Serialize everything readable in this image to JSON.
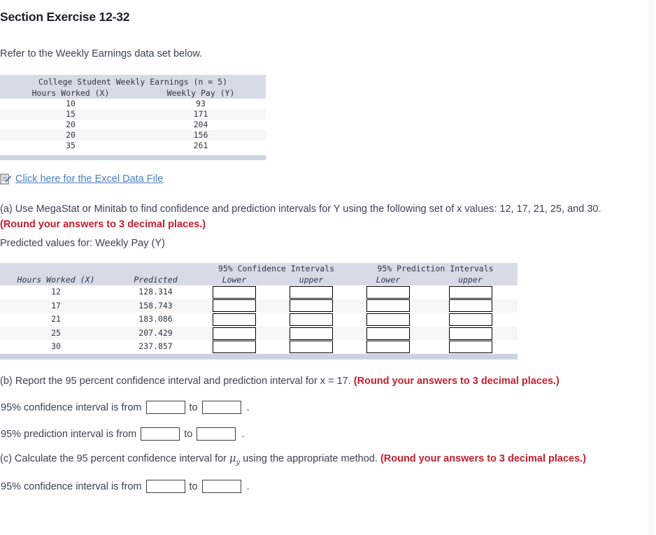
{
  "header": {
    "title": "Section Exercise 12-32",
    "intro": "Refer to the Weekly Earnings data set below."
  },
  "dataset_table": {
    "title": "College Student Weekly Earnings (n = 5)",
    "columns": [
      "Hours Worked (X)",
      "Weekly Pay (Y)"
    ],
    "rows": [
      {
        "x": "10",
        "y": "93"
      },
      {
        "x": "15",
        "y": "171"
      },
      {
        "x": "20",
        "y": "204"
      },
      {
        "x": "20",
        "y": "156"
      },
      {
        "x": "35",
        "y": "261"
      }
    ]
  },
  "excel": {
    "icon": "excel-document-icon",
    "link_text": "Click here for the Excel Data File"
  },
  "question_a": {
    "text": "(a) Use MegaStat or Minitab to find confidence and prediction intervals for Y using the following set of x values: 12, 17, 21, 25, and 30.",
    "round_note": "(Round your answers to 3 decimal places.)",
    "predicted_label": "Predicted values for: Weekly Pay (Y)"
  },
  "results_table": {
    "group_headers": {
      "confidence": "95% Confidence Intervals",
      "prediction": "95% Prediction Intervals"
    },
    "columns": {
      "x": "Hours Worked (X)",
      "predicted": "Predicted",
      "conf_lower": "Lower",
      "conf_upper": "upper",
      "pred_lower": "Lower",
      "pred_upper": "upper"
    },
    "rows": [
      {
        "x": "12",
        "predicted": "128.314",
        "conf_lower": "",
        "conf_upper": "",
        "pred_lower": "",
        "pred_upper": ""
      },
      {
        "x": "17",
        "predicted": "158.743",
        "conf_lower": "",
        "conf_upper": "",
        "pred_lower": "",
        "pred_upper": ""
      },
      {
        "x": "21",
        "predicted": "183.086",
        "conf_lower": "",
        "conf_upper": "",
        "pred_lower": "",
        "pred_upper": ""
      },
      {
        "x": "25",
        "predicted": "207.429",
        "conf_lower": "",
        "conf_upper": "",
        "pred_lower": "",
        "pred_upper": ""
      },
      {
        "x": "30",
        "predicted": "237.857",
        "conf_lower": "",
        "conf_upper": "",
        "pred_lower": "",
        "pred_upper": ""
      }
    ]
  },
  "question_b": {
    "text": "(b) Report the 95 percent confidence interval and prediction interval for x = 17.",
    "round_note": "(Round your answers to 3 decimal places.)",
    "confidence_prefix": "95% confidence interval is from",
    "prediction_prefix": "95% prediction interval is from",
    "to_word": "to",
    "period": ".",
    "confidence_from": "",
    "confidence_to": "",
    "prediction_from": "",
    "prediction_to": ""
  },
  "question_c": {
    "text_before_mu": "(c) Calculate the 95 percent confidence interval for ",
    "mu_symbol": "μ",
    "mu_subscript": "y",
    "text_after_mu": " using the appropriate method.",
    "round_note": "(Round your answers to 3 decimal places.)",
    "confidence_prefix": "95% confidence interval is from",
    "to_word": "to",
    "period": ".",
    "confidence_from": "",
    "confidence_to": ""
  },
  "colors": {
    "header_band": "#d7dbe6",
    "footer_band": "#ccd3e0",
    "row_stripe": "#f6f6f7",
    "link": "#4a7fc1",
    "emphasis_red": "#c31f2e",
    "body_text": "#3b4250"
  }
}
